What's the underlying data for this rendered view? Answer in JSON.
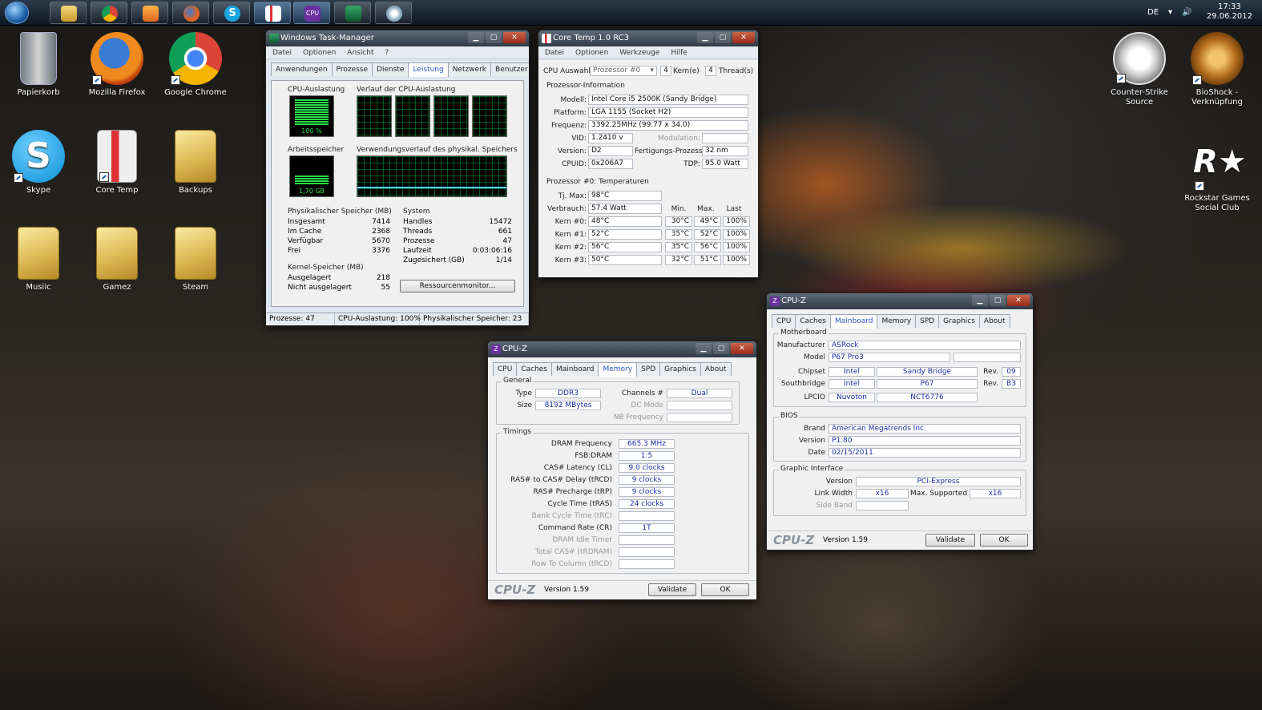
{
  "taskbar": {
    "language": "DE",
    "time": "17:33",
    "date": "29.06.2012",
    "buttons": [
      "explorer-icon",
      "chrome-icon",
      "media-player-icon",
      "firefox-icon",
      "skype-icon",
      "coretemp-icon",
      "cpuz-icon",
      "taskmanager-icon",
      "paint-icon"
    ]
  },
  "desktop": {
    "icons": [
      {
        "label": "Papierkorb"
      },
      {
        "label": "Mozilla Firefox"
      },
      {
        "label": "Google Chrome"
      },
      {
        "label": "Skype"
      },
      {
        "label": "Core Temp"
      },
      {
        "label": "Backups"
      },
      {
        "label": "Musiic"
      },
      {
        "label": "Gamez"
      },
      {
        "label": "Steam"
      },
      {
        "label": "Counter-Strike Source"
      },
      {
        "label": "BioShock -",
        "label2": "Verknüpfung"
      },
      {
        "label": "Rockstar Games",
        "label2": "Social Club"
      }
    ]
  },
  "taskmgr": {
    "title": "Windows Task-Manager",
    "menu": [
      "Datei",
      "Optionen",
      "Ansicht",
      "?"
    ],
    "tabs": [
      "Anwendungen",
      "Prozesse",
      "Dienste",
      "Leistung",
      "Netzwerk",
      "Benutzer"
    ],
    "cpu_label": "CPU-Auslastung",
    "cpu_value": "100 %",
    "cpu_history_label": "Verlauf der CPU-Auslastung",
    "mem_label": "Arbeitsspeicher",
    "mem_value": "1,70 GB",
    "mem_history_label": "Verwendungsverlauf des physikal. Speichers",
    "phys_title": "Physikalischer Speicher (MB)",
    "phys": [
      {
        "k": "Insgesamt",
        "v": "7414"
      },
      {
        "k": "Im Cache",
        "v": "2368"
      },
      {
        "k": "Verfügbar",
        "v": "5670"
      },
      {
        "k": "Frei",
        "v": "3376"
      }
    ],
    "kernel_title": "Kernel-Speicher (MB)",
    "kernel": [
      {
        "k": "Ausgelagert",
        "v": "218"
      },
      {
        "k": "Nicht ausgelagert",
        "v": "55"
      }
    ],
    "system_title": "System",
    "system": [
      {
        "k": "Handles",
        "v": "15472"
      },
      {
        "k": "Threads",
        "v": "661"
      },
      {
        "k": "Prozesse",
        "v": "47"
      },
      {
        "k": "Laufzeit",
        "v": "0:03:06:16"
      },
      {
        "k": "Zugesichert (GB)",
        "v": "1/14"
      }
    ],
    "resmon_button": "Ressourcenmonitor...",
    "status": [
      "Prozesse: 47",
      "CPU-Auslastung: 100%",
      "Physikalischer Speicher: 23"
    ]
  },
  "coretemp": {
    "title": "Core Temp 1.0 RC3",
    "menu": [
      "Datei",
      "Optionen",
      "Werkzeuge",
      "Hilfe"
    ],
    "cpu_select_label": "CPU Auswahl:",
    "cpu_select_value": "Prozessor #0",
    "cores_num": "4",
    "cores_label": "Kern(e)",
    "threads_num": "4",
    "threads_label": "Thread(s)",
    "info_title": "Prozessor-Information",
    "model_label": "Modell:",
    "model": "Intel Core i5 2500K (Sandy Bridge)",
    "platform_label": "Platform:",
    "platform": "LGA 1155 (Socket H2)",
    "freq_label": "Frequenz:",
    "freq": "3392.25MHz (99.77 x 34.0)",
    "vid_label": "VID:",
    "vid": "1.2410 v",
    "modulation_label": "Modulation:",
    "version_label": "Version:",
    "version": "D2",
    "process_label": "Fertigungs-Prozess:",
    "process": "32 nm",
    "cpuid_label": "CPUID:",
    "cpuid": "0x206A7",
    "tdp_label": "TDP:",
    "tdp": "95.0 Watt",
    "temps_title": "Prozessor #0: Temperaturen",
    "tjmax_label": "Tj. Max:",
    "tjmax": "98°C",
    "power_label": "Verbrauch:",
    "power": "57.4 Watt",
    "col_min": "Min.",
    "col_max": "Max.",
    "col_last": "Last",
    "cores": [
      {
        "name": "Kern #0:",
        "temp": "48°C",
        "min": "30°C",
        "max": "49°C",
        "load": "100%"
      },
      {
        "name": "Kern #1:",
        "temp": "52°C",
        "min": "35°C",
        "max": "52°C",
        "load": "100%"
      },
      {
        "name": "Kern #2:",
        "temp": "56°C",
        "min": "35°C",
        "max": "56°C",
        "load": "100%"
      },
      {
        "name": "Kern #3:",
        "temp": "50°C",
        "min": "32°C",
        "max": "51°C",
        "load": "100%"
      }
    ]
  },
  "cpuz_mem": {
    "title": "CPU-Z",
    "tabs": [
      "CPU",
      "Caches",
      "Mainboard",
      "Memory",
      "SPD",
      "Graphics",
      "About"
    ],
    "general_title": "General",
    "type_label": "Type",
    "type": "DDR3",
    "size_label": "Size",
    "size": "8192 MBytes",
    "channels_label": "Channels #",
    "channels": "Dual",
    "dcmode_label": "DC Mode",
    "nbfreq_label": "NB Frequency",
    "timings_title": "Timings",
    "timings": [
      {
        "k": "DRAM Frequency",
        "v": "665.3 MHz",
        "dim": false
      },
      {
        "k": "FSB:DRAM",
        "v": "1:5",
        "dim": false
      },
      {
        "k": "CAS# Latency (CL)",
        "v": "9.0 clocks",
        "dim": false
      },
      {
        "k": "RAS# to CAS# Delay (tRCD)",
        "v": "9 clocks",
        "dim": false
      },
      {
        "k": "RAS# Precharge (tRP)",
        "v": "9 clocks",
        "dim": false
      },
      {
        "k": "Cycle Time (tRAS)",
        "v": "24 clocks",
        "dim": false
      },
      {
        "k": "Bank Cycle Time (tRC)",
        "v": "",
        "dim": true
      },
      {
        "k": "Command Rate (CR)",
        "v": "1T",
        "dim": false
      },
      {
        "k": "DRAM Idle Timer",
        "v": "",
        "dim": true
      },
      {
        "k": "Total CAS# (tRDRAM)",
        "v": "",
        "dim": true
      },
      {
        "k": "Row To Column (tRCD)",
        "v": "",
        "dim": true
      }
    ],
    "logo": "CPU-Z",
    "version": "Version 1.59",
    "validate": "Validate",
    "ok": "OK"
  },
  "cpuz_mb": {
    "title": "CPU-Z",
    "tabs": [
      "CPU",
      "Caches",
      "Mainboard",
      "Memory",
      "SPD",
      "Graphics",
      "About"
    ],
    "mb_title": "Motherboard",
    "manufacturer_label": "Manufacturer",
    "manufacturer": "ASRock",
    "model_label": "Model",
    "model": "P67 Pro3",
    "chipset_label": "Chipset",
    "chipset_vendor": "Intel",
    "chipset_name": "Sandy Bridge",
    "rev_label": "Rev.",
    "chipset_rev": "09",
    "southbridge_label": "Southbridge",
    "sb_vendor": "Intel",
    "sb_name": "P67",
    "sb_rev": "B3",
    "lpcio_label": "LPCIO",
    "lpcio_vendor": "Nuvoton",
    "lpcio_name": "NCT6776",
    "bios_title": "BIOS",
    "brand_label": "Brand",
    "brand": "American Megatrends Inc.",
    "bios_version_label": "Version",
    "bios_version": "P1.80",
    "date_label": "Date",
    "date": "02/15/2011",
    "gi_title": "Graphic Interface",
    "gi_version_label": "Version",
    "gi_version": "PCI-Express",
    "link_width_label": "Link Width",
    "link_width": "x16",
    "max_supported_label": "Max. Supported",
    "max_supported": "x16",
    "side_band_label": "Side Band",
    "logo": "CPU-Z",
    "version": "Version 1.59",
    "validate": "Validate",
    "ok": "OK"
  }
}
